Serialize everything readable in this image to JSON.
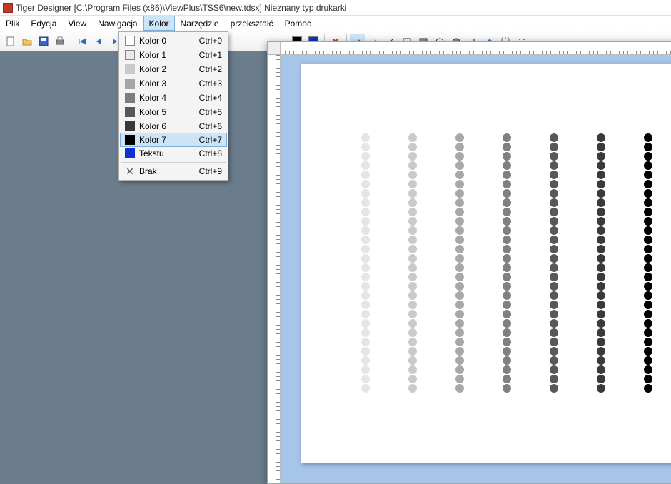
{
  "title": "Tiger Designer [C:\\Program Files (x86)\\ViewPlus\\TSS6\\new.tdsx] Nieznany typ drukarki",
  "menu": {
    "items": [
      "Plik",
      "Edycja",
      "View",
      "Nawigacja",
      "Kolor",
      "Narzędzie",
      "przekształć",
      "Pomoc"
    ],
    "active": "Kolor"
  },
  "dropdown": {
    "items": [
      {
        "label": "Kolor 0",
        "shortcut": "Ctrl+0",
        "color": "#ffffff",
        "border": true
      },
      {
        "label": "Kolor 1",
        "shortcut": "Ctrl+1",
        "color": "#e8e8e8",
        "border": true
      },
      {
        "label": "Kolor 2",
        "shortcut": "Ctrl+2",
        "color": "#c9c9c9",
        "border": false
      },
      {
        "label": "Kolor 3",
        "shortcut": "Ctrl+3",
        "color": "#a5a5a5",
        "border": false
      },
      {
        "label": "Kolor 4",
        "shortcut": "Ctrl+4",
        "color": "#7d7d7d",
        "border": false
      },
      {
        "label": "Kolor 5",
        "shortcut": "Ctrl+5",
        "color": "#585858",
        "border": false
      },
      {
        "label": "Kolor 6",
        "shortcut": "Ctrl+6",
        "color": "#3a3a3a",
        "border": false
      },
      {
        "label": "Kolor 7",
        "shortcut": "Ctrl+7",
        "color": "#000000",
        "border": false,
        "highlight": true
      },
      {
        "label": "Tekstu",
        "shortcut": "Ctrl+8",
        "color": "#1030d0",
        "border": false
      },
      {
        "sep": true
      },
      {
        "label": "Brak",
        "shortcut": "Ctrl+9",
        "icon": "x"
      }
    ]
  },
  "toolbar": {
    "color1": "#000000",
    "color2": "#1030d0"
  },
  "canvas": {
    "rows": 28,
    "columns": [
      {
        "color": "#e5e5e5"
      },
      {
        "color": "#cacaca"
      },
      {
        "color": "#a8a8a8"
      },
      {
        "color": "#808080"
      },
      {
        "color": "#585858"
      },
      {
        "color": "#3a3a3a"
      },
      {
        "color": "#000000"
      }
    ]
  }
}
